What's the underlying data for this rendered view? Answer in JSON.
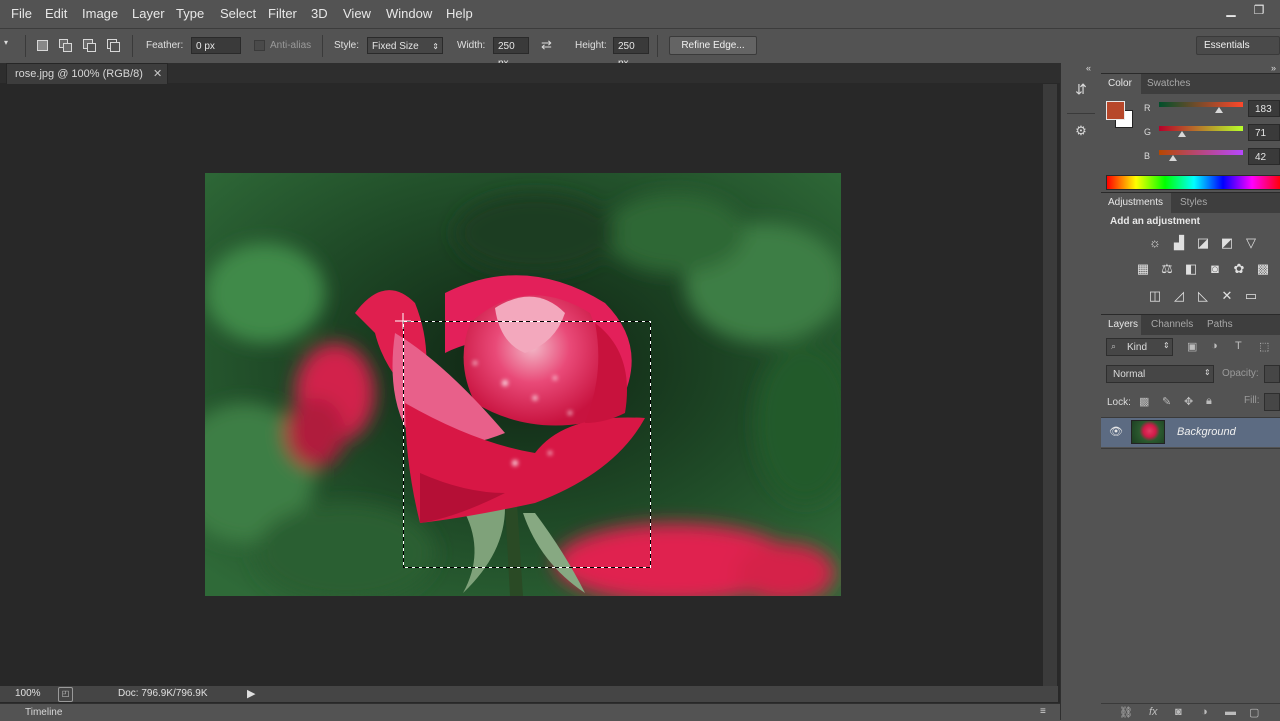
{
  "menu": [
    "File",
    "Edit",
    "Image",
    "Layer",
    "Type",
    "Select",
    "Filter",
    "3D",
    "View",
    "Window",
    "Help"
  ],
  "options": {
    "feather_label": "Feather:",
    "feather_value": "0 px",
    "antialias_label": "Anti-alias",
    "style_label": "Style:",
    "style_value": "Fixed Size",
    "width_label": "Width:",
    "width_value": "250 px",
    "height_label": "Height:",
    "height_value": "250 px",
    "refine_edge": "Refine Edge...",
    "workspace": "Essentials"
  },
  "document": {
    "tab_title": "rose.jpg @ 100% (RGB/8)",
    "zoom": "100%",
    "doc_size": "Doc: 796.9K/796.9K",
    "timeline_label": "Timeline"
  },
  "color_panel": {
    "tabs": [
      "Color",
      "Swatches"
    ],
    "foreground_color": "#b7472a",
    "channels": [
      {
        "label": "R",
        "value": "183"
      },
      {
        "label": "G",
        "value": "71"
      },
      {
        "label": "B",
        "value": "42"
      }
    ]
  },
  "adjustments_panel": {
    "tabs": [
      "Adjustments",
      "Styles"
    ],
    "title": "Add an adjustment"
  },
  "layers_panel": {
    "tabs": [
      "Layers",
      "Channels",
      "Paths"
    ],
    "filter_kind": "Kind",
    "blend_mode": "Normal",
    "opacity_label": "Opacity:",
    "lock_label": "Lock:",
    "fill_label": "Fill:",
    "layers": [
      {
        "name": "Background",
        "visible": true
      }
    ]
  }
}
